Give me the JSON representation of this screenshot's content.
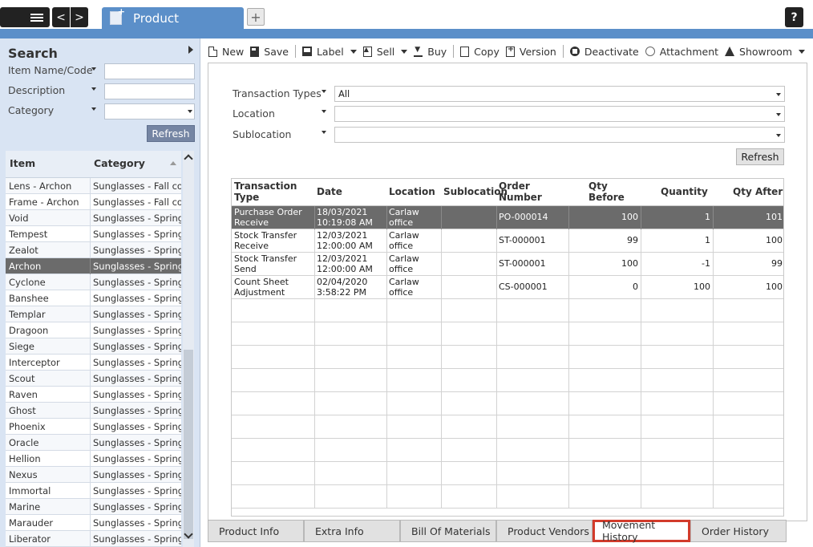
{
  "header": {
    "tab_title": "Product",
    "add_tab_label": "+",
    "help_label": "?",
    "back_label": "<",
    "forward_label": ">"
  },
  "search": {
    "title": "Search",
    "filters": [
      {
        "label": "Item Name/Code"
      },
      {
        "label": "Description"
      },
      {
        "label": "Category"
      }
    ],
    "refresh_label": "Refresh"
  },
  "items": {
    "columns": [
      "Item",
      "Category"
    ],
    "rows": [
      {
        "item": "Lens - Archon",
        "category": "Sunglasses - Fall col..."
      },
      {
        "item": "Frame - Archon",
        "category": "Sunglasses - Fall col..."
      },
      {
        "item": "Void",
        "category": "Sunglasses - Spring ..."
      },
      {
        "item": "Tempest",
        "category": "Sunglasses - Spring ..."
      },
      {
        "item": "Zealot",
        "category": "Sunglasses - Spring ..."
      },
      {
        "item": "Archon",
        "category": "Sunglasses - Spring ...",
        "selected": true
      },
      {
        "item": "Cyclone",
        "category": "Sunglasses - Spring ..."
      },
      {
        "item": "Banshee",
        "category": "Sunglasses - Spring ..."
      },
      {
        "item": "Templar",
        "category": "Sunglasses - Spring ..."
      },
      {
        "item": "Dragoon",
        "category": "Sunglasses - Spring ..."
      },
      {
        "item": "Siege",
        "category": "Sunglasses - Spring ..."
      },
      {
        "item": "Interceptor",
        "category": "Sunglasses - Spring ..."
      },
      {
        "item": "Scout",
        "category": "Sunglasses - Spring ..."
      },
      {
        "item": "Raven",
        "category": "Sunglasses - Spring ..."
      },
      {
        "item": "Ghost",
        "category": "Sunglasses - Spring ..."
      },
      {
        "item": "Phoenix",
        "category": "Sunglasses - Spring ..."
      },
      {
        "item": "Oracle",
        "category": "Sunglasses - Spring ..."
      },
      {
        "item": "Hellion",
        "category": "Sunglasses - Spring ..."
      },
      {
        "item": "Nexus",
        "category": "Sunglasses - Spring ..."
      },
      {
        "item": "Immortal",
        "category": "Sunglasses - Spring ..."
      },
      {
        "item": "Marine",
        "category": "Sunglasses - Spring ..."
      },
      {
        "item": "Marauder",
        "category": "Sunglasses - Spring ..."
      },
      {
        "item": "Liberator",
        "category": "Sunglasses - Spring ..."
      }
    ]
  },
  "toolbar": {
    "items": [
      {
        "label": "New",
        "icon": "new-doc-icon"
      },
      {
        "label": "Save",
        "icon": "save-icon"
      },
      {
        "label": "Label",
        "icon": "label-icon",
        "dropdown": true
      },
      {
        "label": "Sell",
        "icon": "sell-icon",
        "dropdown": true
      },
      {
        "label": "Buy",
        "icon": "buy-icon"
      },
      {
        "label": "Copy",
        "icon": "copy-icon"
      },
      {
        "label": "Version",
        "icon": "version-icon"
      },
      {
        "label": "Deactivate",
        "icon": "deactivate-icon"
      },
      {
        "label": "Attachment",
        "icon": "paperclip-icon"
      },
      {
        "label": "Showroom",
        "icon": "showroom-icon",
        "dropdown": true
      }
    ]
  },
  "movement": {
    "filters": [
      {
        "label": "Transaction Types",
        "value": "All"
      },
      {
        "label": "Location",
        "value": ""
      },
      {
        "label": "Sublocation",
        "value": ""
      }
    ],
    "refresh_label": "Refresh",
    "columns": [
      "Transaction Type",
      "Date",
      "Location",
      "Sublocation",
      "Order Number",
      "Qty Before",
      "Quantity",
      "Qty After"
    ],
    "rows": [
      {
        "type": "Purchase Order Receive",
        "date": "18/03/2021 10:19:08 AM",
        "location": "Carlaw office",
        "sublocation": "",
        "order": "PO-000014",
        "before": "100",
        "qty": "1",
        "after": "101",
        "selected": true
      },
      {
        "type": "Stock Transfer Receive",
        "date": "12/03/2021 12:00:00 AM",
        "location": "Carlaw office",
        "sublocation": "",
        "order": "ST-000001",
        "before": "99",
        "qty": "1",
        "after": "100"
      },
      {
        "type": "Stock Transfer Send",
        "date": "12/03/2021 12:00:00 AM",
        "location": "Carlaw office",
        "sublocation": "",
        "order": "ST-000001",
        "before": "100",
        "qty": "-1",
        "after": "99"
      },
      {
        "type": "Count Sheet Adjustment",
        "date": "02/04/2020 3:58:22 PM",
        "location": "Carlaw office",
        "sublocation": "",
        "order": "CS-000001",
        "before": "0",
        "qty": "100",
        "after": "100"
      }
    ]
  },
  "bottom_tabs": [
    {
      "label": "Product Info"
    },
    {
      "label": "Extra Info"
    },
    {
      "label": "Bill Of Materials"
    },
    {
      "label": "Product Vendors"
    },
    {
      "label": "Movement History",
      "active": true
    },
    {
      "label": "Order History"
    }
  ],
  "colors": {
    "accent_blue": "#5b8fc9",
    "selected_row": "#6b6b6b",
    "active_tab_border": "#d23b2b"
  }
}
